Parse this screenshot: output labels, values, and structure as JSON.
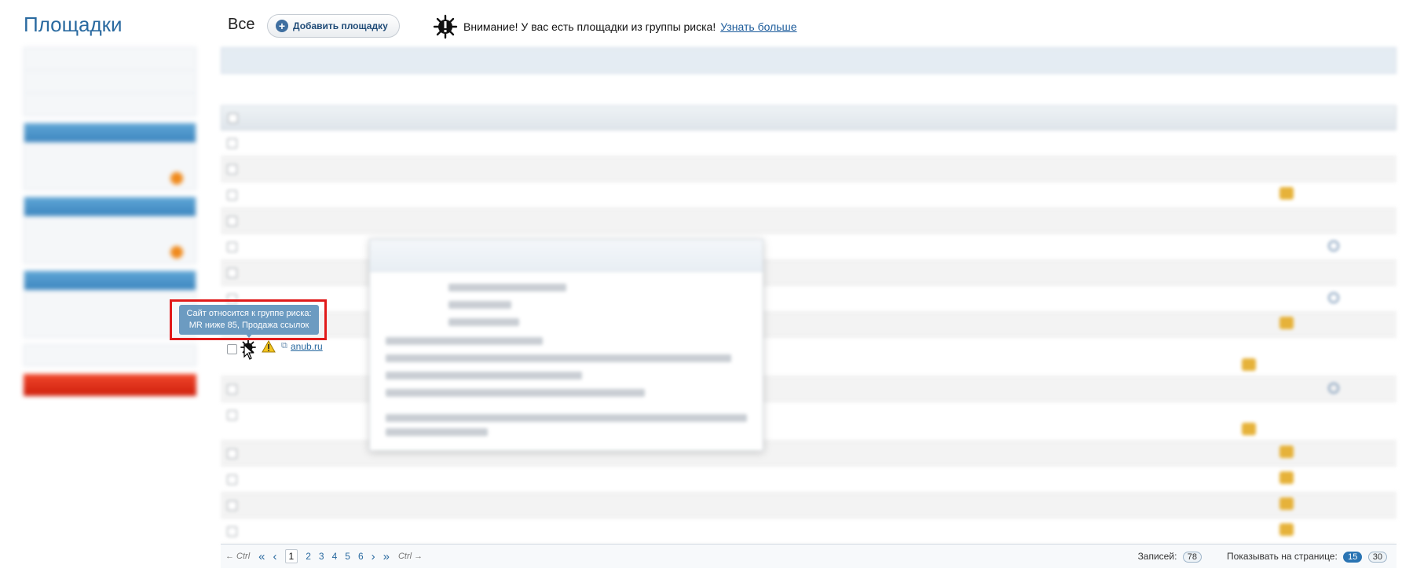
{
  "sidebar": {
    "title": "Площадки"
  },
  "header": {
    "filter_label": "Все",
    "add_button": "Добавить площадку",
    "warning_text": "Внимание! У вас есть площадки из группы риска!",
    "warning_link": "Узнать больше"
  },
  "tooltip": {
    "line1": "Сайт относится к группе риска:",
    "line2": "MR ниже 85, Продажа ссылок"
  },
  "focused_row": {
    "site": "anub.ru"
  },
  "pagination": {
    "prev_hint": "← Ctrl",
    "next_hint": "Ctrl →",
    "first": "«",
    "prev": "‹",
    "pages": [
      "1",
      "2",
      "3",
      "4",
      "5",
      "6"
    ],
    "active_page": "1",
    "next": "›",
    "last": "»",
    "records_label": "Записей:",
    "records_count": "78",
    "per_page_label": "Показывать на странице:",
    "per_page_options": [
      "15",
      "30"
    ],
    "per_page_selected": "15"
  },
  "colors": {
    "accent": "#2a6aa0",
    "tooltip_bg": "#6c9bc1",
    "highlight_frame": "#e11a1a",
    "warning_orange": "#e06010"
  }
}
